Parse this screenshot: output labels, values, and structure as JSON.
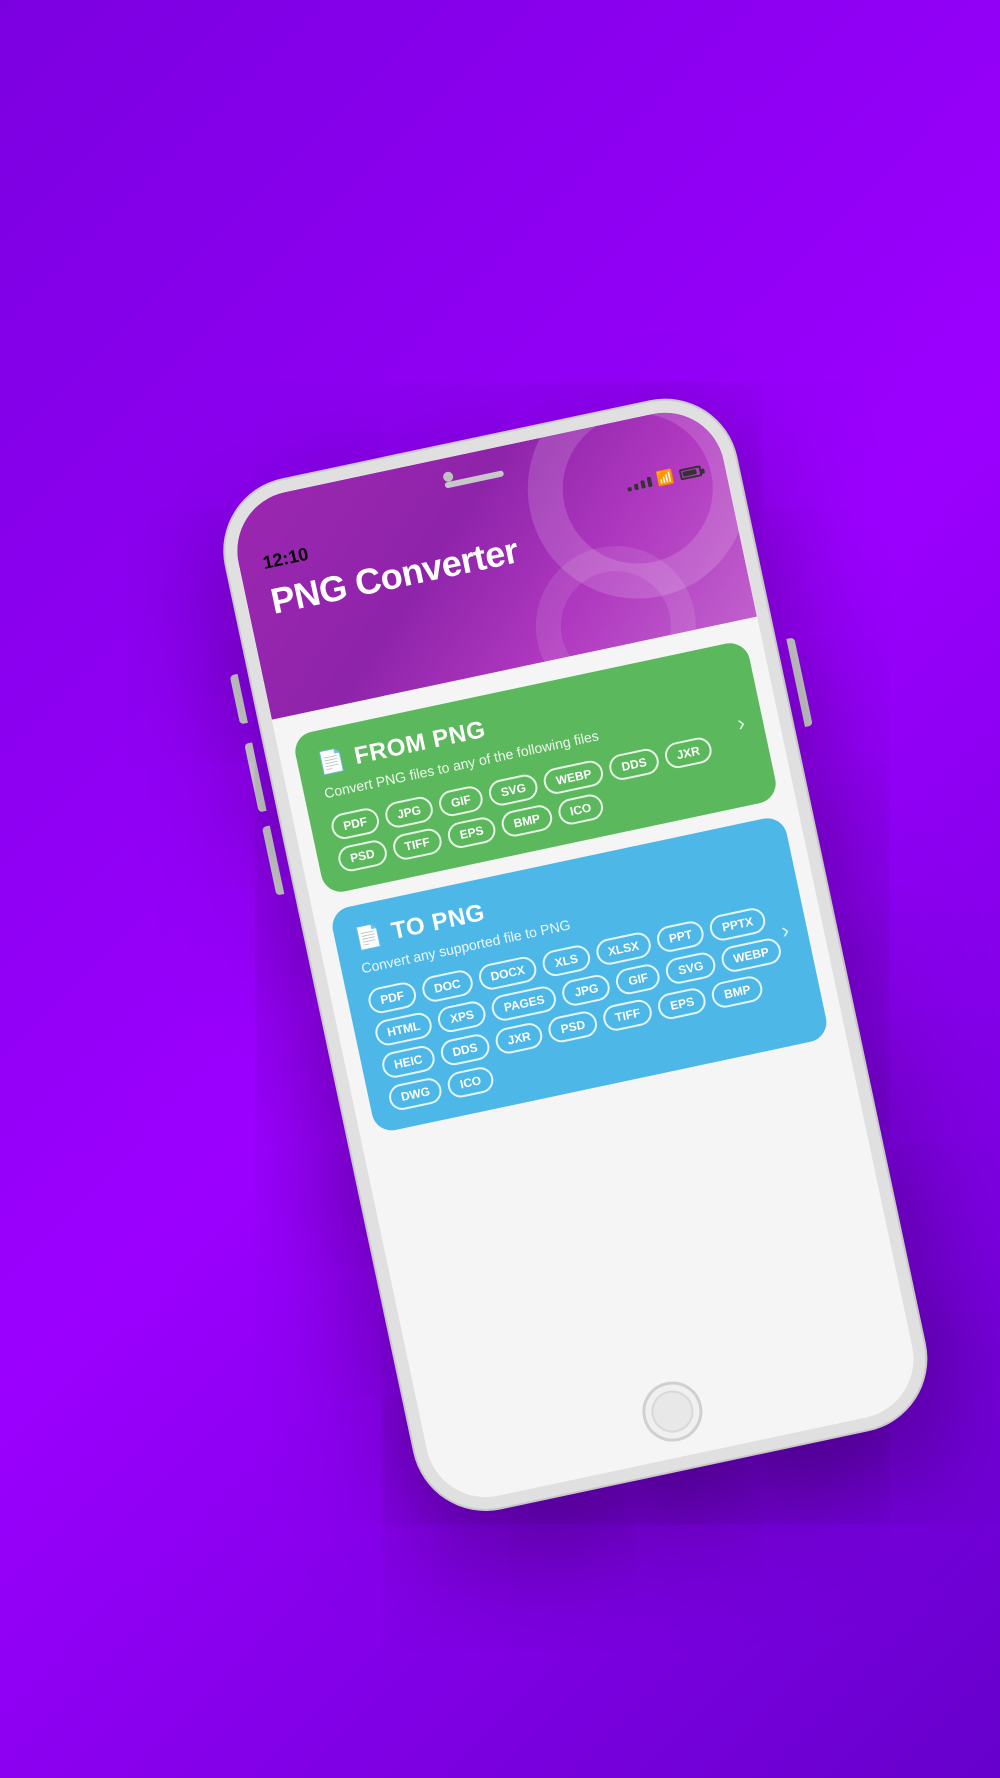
{
  "background": {
    "color": "#8800ee"
  },
  "status_bar": {
    "time": "12:10"
  },
  "header": {
    "title": "PNG Converter"
  },
  "from_png_card": {
    "title": "FROM PNG",
    "description": "Convert PNG files to any of the following files",
    "arrow": "›",
    "formats": [
      "PDF",
      "JPG",
      "GIF",
      "SVG",
      "WEBP",
      "DDS",
      "JXR",
      "PSD",
      "TIFF",
      "EPS",
      "BMP",
      "ICO"
    ]
  },
  "to_png_card": {
    "title": "TO PNG",
    "description": "Convert any supported file to PNG",
    "arrow": "›",
    "formats": [
      "PDF",
      "DOC",
      "DOCX",
      "XLS",
      "XLSX",
      "PPT",
      "PPTX",
      "HTML",
      "XPS",
      "PAGES",
      "JPG",
      "GIF",
      "SVG",
      "WEBP",
      "HEIC",
      "DDS",
      "JXR",
      "PSD",
      "TIFF",
      "EPS",
      "BMP",
      "DWG",
      "ICO"
    ]
  }
}
